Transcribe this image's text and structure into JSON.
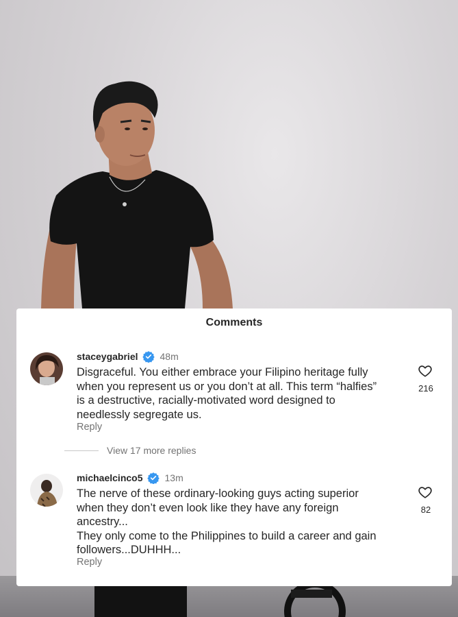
{
  "sheet": {
    "title": "Comments"
  },
  "comments": [
    {
      "username": "staceygabriel",
      "time": "48m",
      "lines": [
        "Disgraceful. You either embrace your Filipino heritage fully",
        "when you represent us or you don’t at all. This term “halfies”",
        "is a destructive, racially-motivated word designed to",
        "needlessly segregate us."
      ],
      "reply_label": "Reply",
      "likes": "216"
    },
    {
      "username": "michaelcinco5",
      "time": "13m",
      "lines": [
        "The nerve of these ordinary-looking guys acting superior",
        "when they don’t even look like they have any foreign",
        "ancestry...",
        "They only come to the Philippines to build a career and gain",
        "followers...DUHHH..."
      ],
      "reply_label": "Reply",
      "likes": "82"
    }
  ],
  "view_more": "View 17 more replies",
  "colors": {
    "verified": "#3797f0",
    "text": "#262626",
    "muted": "#737373"
  },
  "icons": [
    "verified-badge-icon",
    "heart-outline-icon"
  ]
}
